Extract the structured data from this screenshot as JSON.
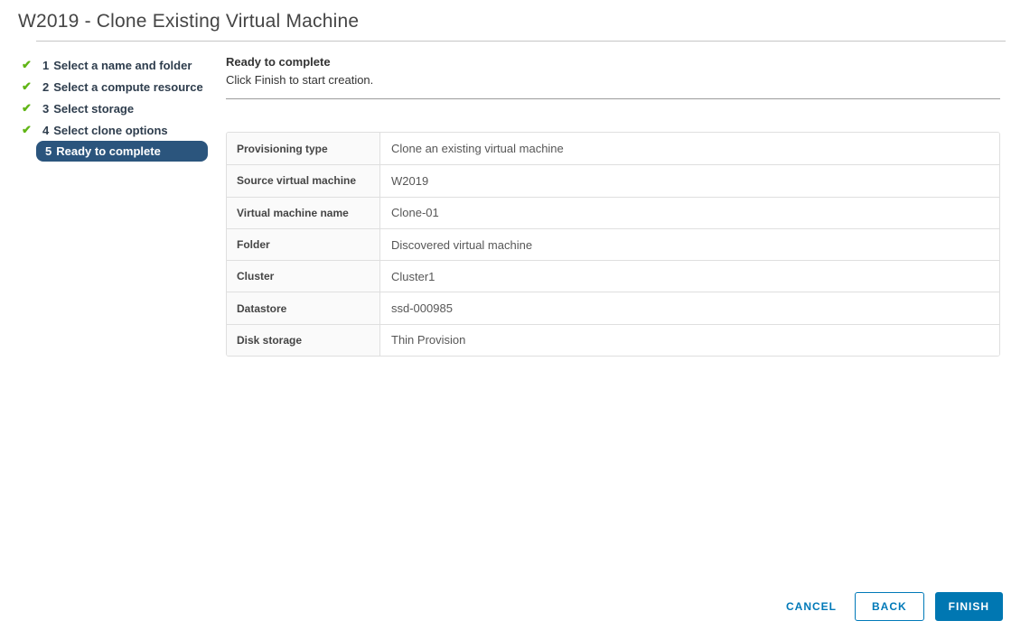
{
  "title": "W2019 - Clone Existing Virtual Machine",
  "steps": [
    {
      "number": "1",
      "label": "Select a name and folder",
      "completed": true
    },
    {
      "number": "2",
      "label": "Select a compute resource",
      "completed": true
    },
    {
      "number": "3",
      "label": "Select storage",
      "completed": true
    },
    {
      "number": "4",
      "label": "Select clone options",
      "completed": true
    },
    {
      "number": "5",
      "label": "Ready to complete",
      "completed": false,
      "active": true
    }
  ],
  "panel": {
    "heading": "Ready to complete",
    "subheading": "Click Finish to start creation."
  },
  "summary": {
    "rows": [
      {
        "label": "Provisioning type",
        "value": "Clone an existing virtual machine"
      },
      {
        "label": "Source virtual machine",
        "value": "W2019"
      },
      {
        "label": "Virtual machine name",
        "value": "Clone-01"
      },
      {
        "label": "Folder",
        "value": "Discovered virtual machine"
      },
      {
        "label": "Cluster",
        "value": "Cluster1"
      },
      {
        "label": "Datastore",
        "value": "ssd-000985"
      },
      {
        "label": "Disk storage",
        "value": "Thin Provision"
      }
    ]
  },
  "buttons": {
    "cancel": "CANCEL",
    "back": "BACK",
    "finish": "FINISH"
  },
  "icons": {
    "completed_step": "check-icon",
    "check_glyph": "✔"
  },
  "colors": {
    "accent_blue": "#0079B8",
    "finish_button_bg": "#0077B2",
    "active_step_bg": "#2B557D",
    "success_green": "#60B515",
    "step_text": "#2e3d4d",
    "title_text": "#454545"
  }
}
